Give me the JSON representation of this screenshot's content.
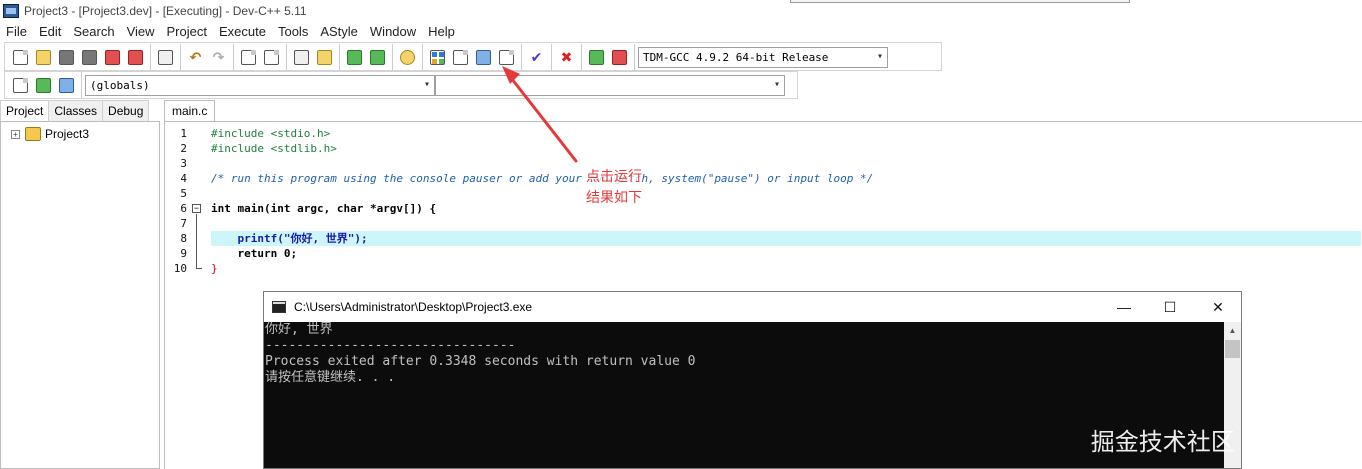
{
  "window": {
    "title": "Project3 - [Project3.dev] - [Executing] - Dev-C++ 5.11"
  },
  "menu": [
    "File",
    "Edit",
    "Search",
    "View",
    "Project",
    "Execute",
    "Tools",
    "AStyle",
    "Window",
    "Help"
  ],
  "toolbar": {
    "compiler_select": "TDM-GCC 4.9.2 64-bit Release",
    "globals_select": "(globals)",
    "member_select": ""
  },
  "sidebar": {
    "tabs": [
      "Project",
      "Classes",
      "Debug"
    ],
    "active_tab": "Project",
    "tree": [
      {
        "label": "Project3",
        "toggle": "+"
      }
    ]
  },
  "editor": {
    "tab_label": "main.c",
    "line_numbers": [
      "1",
      "2",
      "3",
      "4",
      "5",
      "6",
      "7",
      "8",
      "9",
      "10"
    ],
    "fold_markers": [
      "−"
    ],
    "lines": [
      "#include <stdio.h>",
      "#include <stdlib.h>",
      "",
      "/* run this program using the console pauser or add your own getch, system(\"pause\") or input loop */",
      "",
      "int main(int argc, char *argv[]) {",
      "",
      "    printf(\"你好, 世界\");",
      "    return 0;",
      "}"
    ]
  },
  "annotation": {
    "line1": "点击运行",
    "line2": "结果如下",
    "color": "#e53a3a"
  },
  "console": {
    "title": "C:\\Users\\Administrator\\Desktop\\Project3.exe",
    "lines": [
      "你好, 世界",
      "--------------------------------",
      "Process exited after 0.3348 seconds with return value 0",
      "请按任意键继续. . ."
    ],
    "minimize": "—",
    "maximize": "☐",
    "close": "✕"
  },
  "watermark": "掘金技术社区 @ 三维鱼",
  "icons": {
    "toolbar_row1": [
      "new-file-icon",
      "open-icon",
      "save-icon",
      "save-all-icon",
      "close-file-icon",
      "close-all-icon",
      "print-icon",
      "undo-icon",
      "redo-icon",
      "find-icon",
      "replace-icon",
      "goto-icon",
      "indent-icon",
      "compile-icon",
      "run-icon",
      "debug-icon",
      "compile-run-icon",
      "rebuild-icon",
      "layout-icon",
      "tile-icon",
      "check-icon",
      "stop-icon",
      "chart-icon",
      "profile-icon"
    ],
    "toolbar_row2": [
      "add-to-project-icon",
      "remove-from-project-icon",
      "project-options-icon"
    ]
  }
}
